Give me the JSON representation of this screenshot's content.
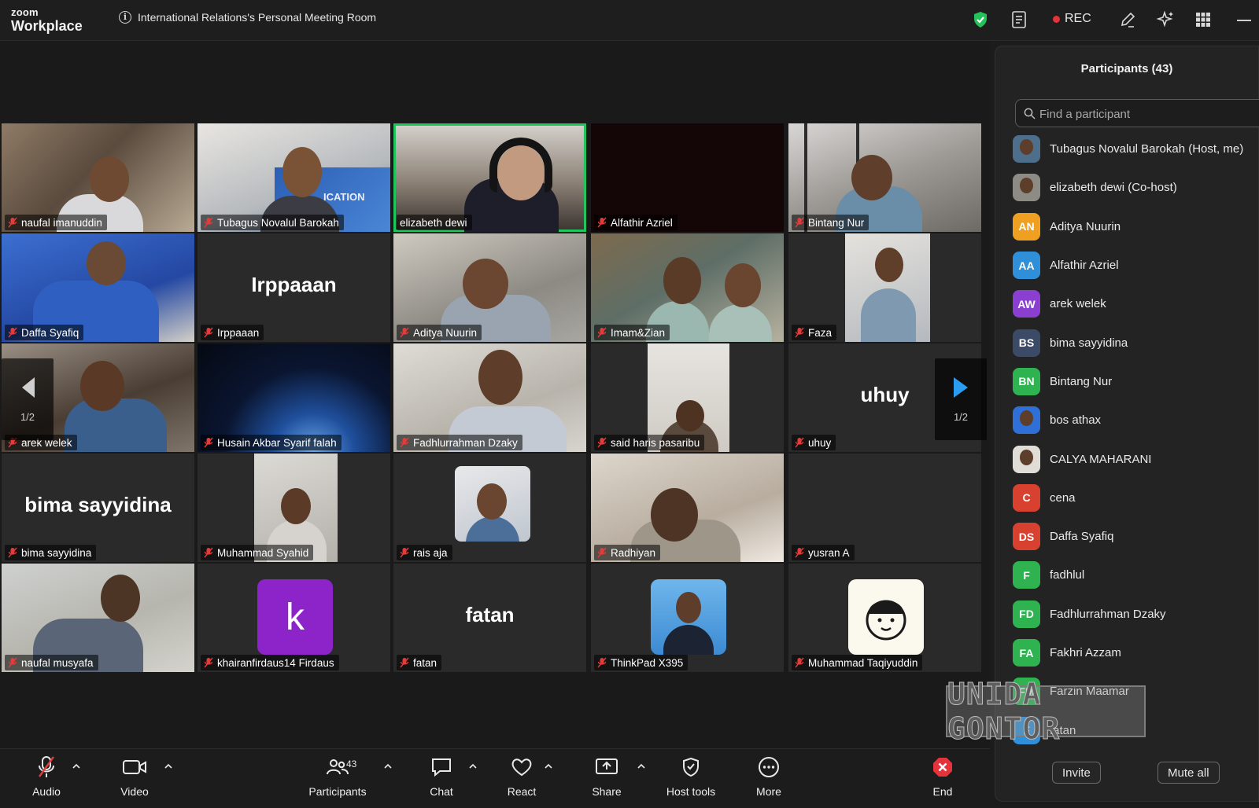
{
  "app": {
    "brand_top": "zoom",
    "brand_bottom": "Workplace",
    "room_title": "International Relations's Personal Meeting Room",
    "rec_label": "REC"
  },
  "tiles": [
    {
      "name": "naufal imanuddin"
    },
    {
      "name": "Tubagus Novalul Barokah",
      "banner": "ICATION"
    },
    {
      "name": "elizabeth dewi"
    },
    {
      "name": "Alfathir Azriel"
    },
    {
      "name": "Bintang Nur"
    },
    {
      "name": "Daffa Syafiq"
    },
    {
      "name": "Irppaaan",
      "display": "Irppaaan"
    },
    {
      "name": "Aditya Nuurin"
    },
    {
      "name": "Imam&Zian"
    },
    {
      "name": "Faza"
    },
    {
      "name": "arek welek"
    },
    {
      "name": "Husain Akbar Syarif falah"
    },
    {
      "name": "Fadhlurrahman Dzaky"
    },
    {
      "name": "said haris pasaribu"
    },
    {
      "name": "uhuy",
      "display": "uhuy"
    },
    {
      "name": "bima sayyidina",
      "display": "bima sayyidina"
    },
    {
      "name": "Muhammad Syahid"
    },
    {
      "name": "rais aja"
    },
    {
      "name": "Radhiyan"
    },
    {
      "name": "yusran A"
    },
    {
      "name": "naufal musyafa"
    },
    {
      "name": "khairanfirdaus14 Firdaus",
      "avatar_letter": "k"
    },
    {
      "name": "fatan",
      "display": "fatan"
    },
    {
      "name": "ThinkPad X395"
    },
    {
      "name": "Muhammad Taqiyuddin"
    }
  ],
  "pagination": {
    "left": "1/2",
    "right": "1/2"
  },
  "panel": {
    "title": "Participants (43)",
    "search_placeholder": "Find a participant",
    "participants": [
      {
        "initials": "",
        "name": "Tubagus Novalul Barokah (Host, me)",
        "color": "#4d6f8c",
        "photo": true
      },
      {
        "initials": "",
        "name": "elizabeth dewi (Co-host)",
        "color": "#8c8c84",
        "photo": true
      },
      {
        "initials": "AN",
        "name": "Aditya Nuurin",
        "color": "#f0a020"
      },
      {
        "initials": "AA",
        "name": "Alfathir Azriel",
        "color": "#2f8fd8"
      },
      {
        "initials": "AW",
        "name": "arek welek",
        "color": "#8a3fd0"
      },
      {
        "initials": "BS",
        "name": "bima sayyidina",
        "color": "#3b4a66"
      },
      {
        "initials": "BN",
        "name": "Bintang Nur",
        "color": "#2fb350"
      },
      {
        "initials": "",
        "name": "bos athax",
        "color": "#2f6fd8",
        "photo": true
      },
      {
        "initials": "",
        "name": "CALYA MAHARANI",
        "color": "#e0ddd6",
        "photo": true
      },
      {
        "initials": "C",
        "name": "cena",
        "color": "#d8402f"
      },
      {
        "initials": "DS",
        "name": "Daffa Syafiq",
        "color": "#d8402f"
      },
      {
        "initials": "F",
        "name": "fadhlul",
        "color": "#2fb350"
      },
      {
        "initials": "FD",
        "name": "Fadhlurrahman Dzaky",
        "color": "#2fb350"
      },
      {
        "initials": "FA",
        "name": "Fakhri Azzam",
        "color": "#2fb350"
      },
      {
        "initials": "FM",
        "name": "Farzin Maamar",
        "color": "#2fb350"
      },
      {
        "initials": "F",
        "name": "fatan",
        "color": "#2f8fd8"
      }
    ],
    "invite_label": "Invite",
    "mute_all_label": "Mute all"
  },
  "watermark": "UNIDA GONTOR",
  "toolbar": {
    "audio": "Audio",
    "video": "Video",
    "participants": "Participants",
    "participants_count": "43",
    "chat": "Chat",
    "react": "React",
    "share": "Share",
    "host_tools": "Host tools",
    "more": "More",
    "end": "End"
  }
}
